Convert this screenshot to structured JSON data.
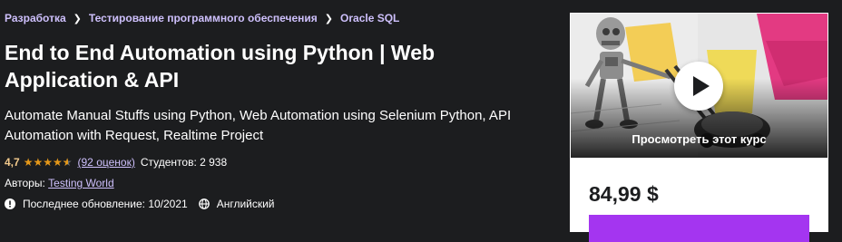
{
  "breadcrumb": [
    "Разработка",
    "Тестирование программного обеспечения",
    "Oracle SQL"
  ],
  "course": {
    "title": "End to End Automation using Python | Web Application & API",
    "subtitle": "Automate Manual Stuffs using Python, Web Automation using Selenium Python, API Automation with Request, Realtime Project",
    "rating": "4,7",
    "stars_filled": 4.5,
    "stars_max": 5,
    "reviews": "(92 оценок)",
    "students": "Студентов: 2 938",
    "authors_label": "Авторы:",
    "author": "Testing World",
    "last_updated": "Последнее обновление: 10/2021",
    "language": "Английский"
  },
  "card": {
    "preview_label": "Просмотреть этот курс",
    "price": "84,99 $"
  },
  "colors": {
    "background": "#1c1d1f",
    "link": "#cec0fc",
    "rating_text": "#f3ca8c",
    "star": "#e59819",
    "accent": "#a435f0"
  },
  "icons": [
    "play-icon",
    "alert-icon",
    "globe-icon",
    "star-icon",
    "chevron-right-icon"
  ]
}
